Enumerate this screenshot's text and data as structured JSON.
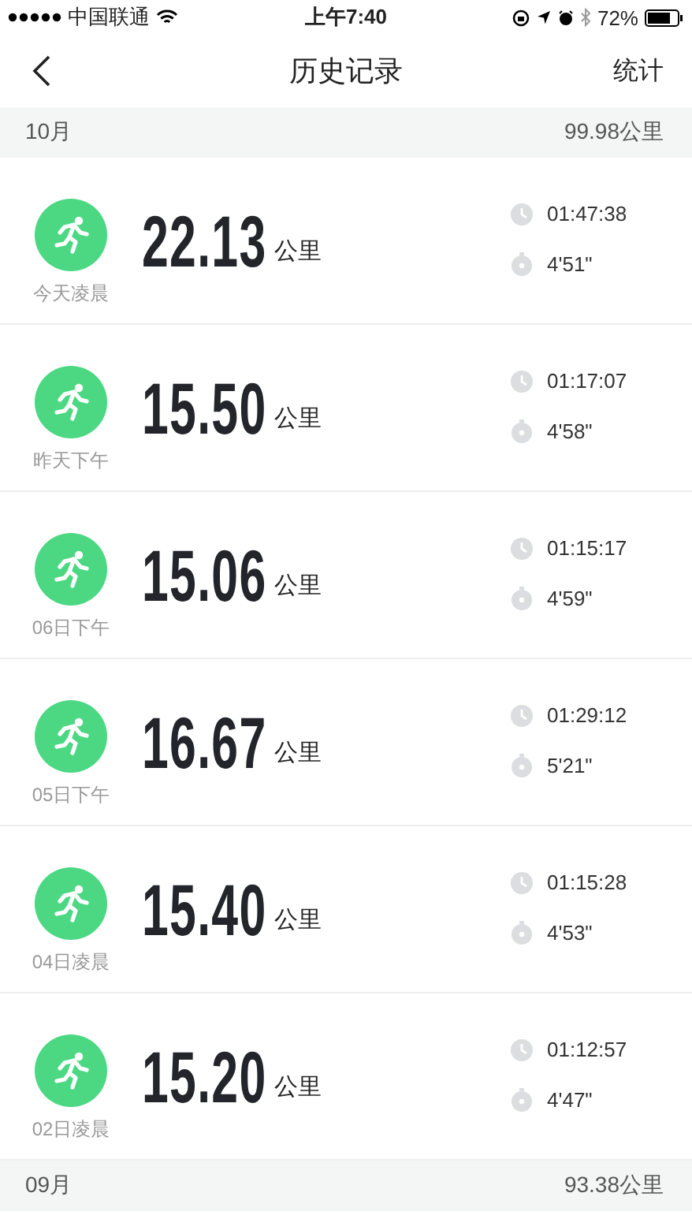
{
  "status_bar": {
    "carrier": "中国联通",
    "time": "上午7:40",
    "battery": "72%"
  },
  "nav": {
    "title": "历史记录",
    "action": "统计"
  },
  "sections": [
    {
      "month": "10月",
      "total": "99.98公里",
      "records": [
        {
          "distance": "22.13",
          "unit": "公里",
          "when": "今天凌晨",
          "duration": "01:47:38",
          "pace": "4'51\""
        },
        {
          "distance": "15.50",
          "unit": "公里",
          "when": "昨天下午",
          "duration": "01:17:07",
          "pace": "4'58\""
        },
        {
          "distance": "15.06",
          "unit": "公里",
          "when": "06日下午",
          "duration": "01:15:17",
          "pace": "4'59\""
        },
        {
          "distance": "16.67",
          "unit": "公里",
          "when": "05日下午",
          "duration": "01:29:12",
          "pace": "5'21\""
        },
        {
          "distance": "15.40",
          "unit": "公里",
          "when": "04日凌晨",
          "duration": "01:15:28",
          "pace": "4'53\""
        },
        {
          "distance": "15.20",
          "unit": "公里",
          "when": "02日凌晨",
          "duration": "01:12:57",
          "pace": "4'47\""
        }
      ]
    },
    {
      "month": "09月",
      "total": "93.38公里"
    }
  ]
}
